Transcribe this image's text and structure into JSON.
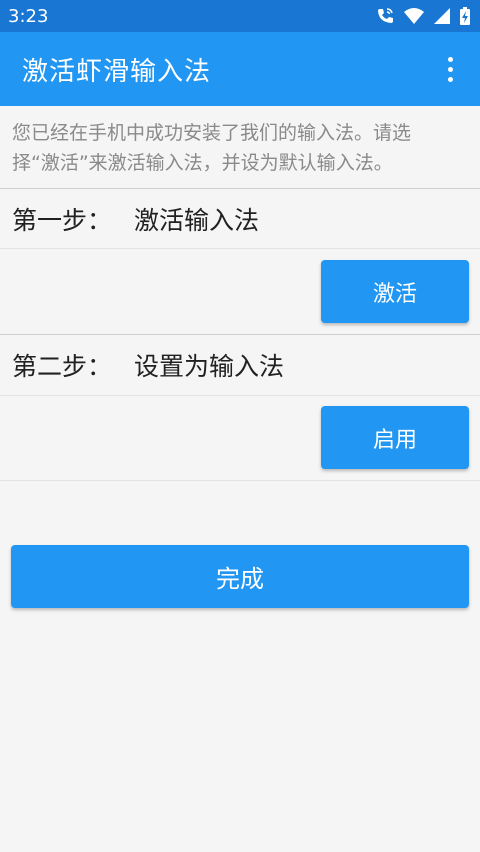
{
  "status_bar": {
    "time": "3:23",
    "icons": [
      "wifi-calling-icon",
      "wifi-icon",
      "signal-icon",
      "battery-charging-icon"
    ],
    "background": "#1976d2"
  },
  "app_bar": {
    "title": "激活虾滑输入法",
    "menu_icon": "overflow-menu-icon",
    "background": "#2196f3"
  },
  "description": {
    "line1": "您已经在手机中成功安装了我们的输入法。请选",
    "line2": "择“激活”来激活输入法，并设为默认输入法。"
  },
  "steps": [
    {
      "prefix": "第一步：",
      "title": "激活输入法",
      "button_label": "激活"
    },
    {
      "prefix": "第二步：",
      "title": "设置为输入法",
      "button_label": "启用"
    }
  ],
  "done_button": {
    "label": "完成"
  },
  "colors": {
    "accent": "#2196f3",
    "text_primary": "#212121",
    "text_secondary": "#8a8a8a"
  }
}
